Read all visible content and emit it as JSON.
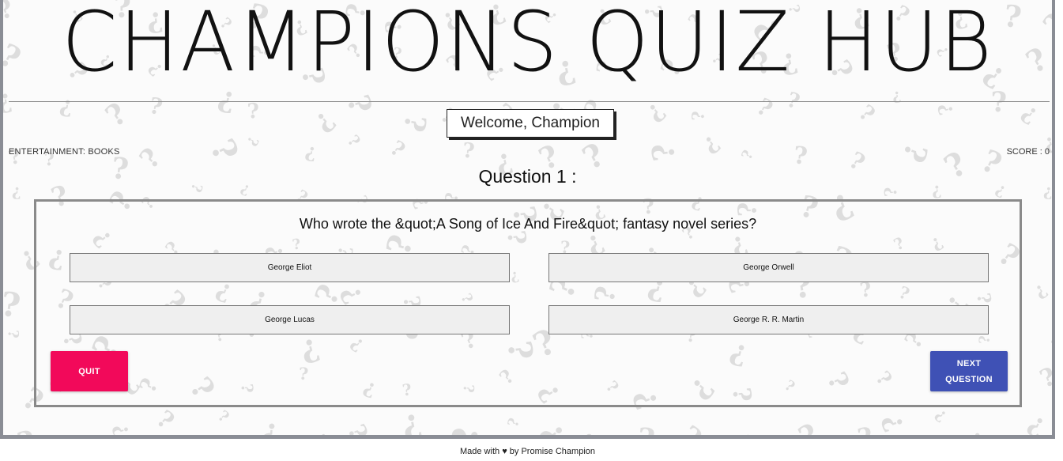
{
  "header": {
    "site_title": "CHAMPIONS QUIZ HUB",
    "welcome": "Welcome, Champion"
  },
  "status": {
    "category": "ENTERTAINMENT: BOOKS",
    "score": "SCORE : 0"
  },
  "quiz": {
    "question_number": "Question 1 :",
    "question_text": "Who wrote the &quot;A Song of Ice And Fire&quot; fantasy novel series?",
    "answers": [
      "George Eliot",
      "George Orwell",
      "George Lucas",
      "George R. R. Martin"
    ],
    "quit_label": "QUIT",
    "next_label": "NEXT\nQUESTION"
  },
  "footer": {
    "made_with": "Made with",
    "heart": "♥",
    "author": "by Promise Champion"
  },
  "colors": {
    "quit": "#f2095a",
    "next": "#3f51b5",
    "frame": "#8a8d95"
  }
}
